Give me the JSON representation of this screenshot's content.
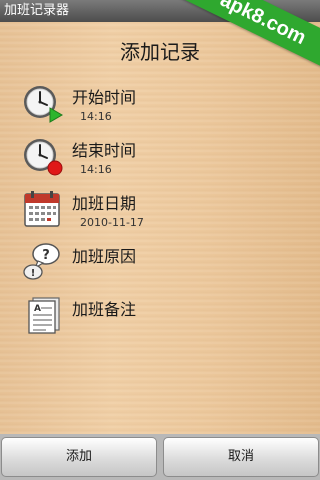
{
  "app": {
    "window_title": "加班记录器"
  },
  "watermark": {
    "text": "apk8.com"
  },
  "page": {
    "title": "添加记录"
  },
  "rows": [
    {
      "label": "开始时间",
      "value": "14:16",
      "icon": "clock-start-icon"
    },
    {
      "label": "结束时间",
      "value": "14:16",
      "icon": "clock-stop-icon"
    },
    {
      "label": "加班日期",
      "value": "2010-11-17",
      "icon": "calendar-icon"
    },
    {
      "label": "加班原因",
      "value": "",
      "icon": "question-bubble-icon"
    },
    {
      "label": "加班备注",
      "value": "",
      "icon": "notes-icon"
    }
  ],
  "buttons": {
    "add": "添加",
    "cancel": "取消"
  },
  "colors": {
    "background": "#e8c498",
    "watermark": "#2fa82f",
    "start_accent": "#2db52d",
    "stop_accent": "#e01818",
    "calendar_accent": "#c0392b"
  }
}
